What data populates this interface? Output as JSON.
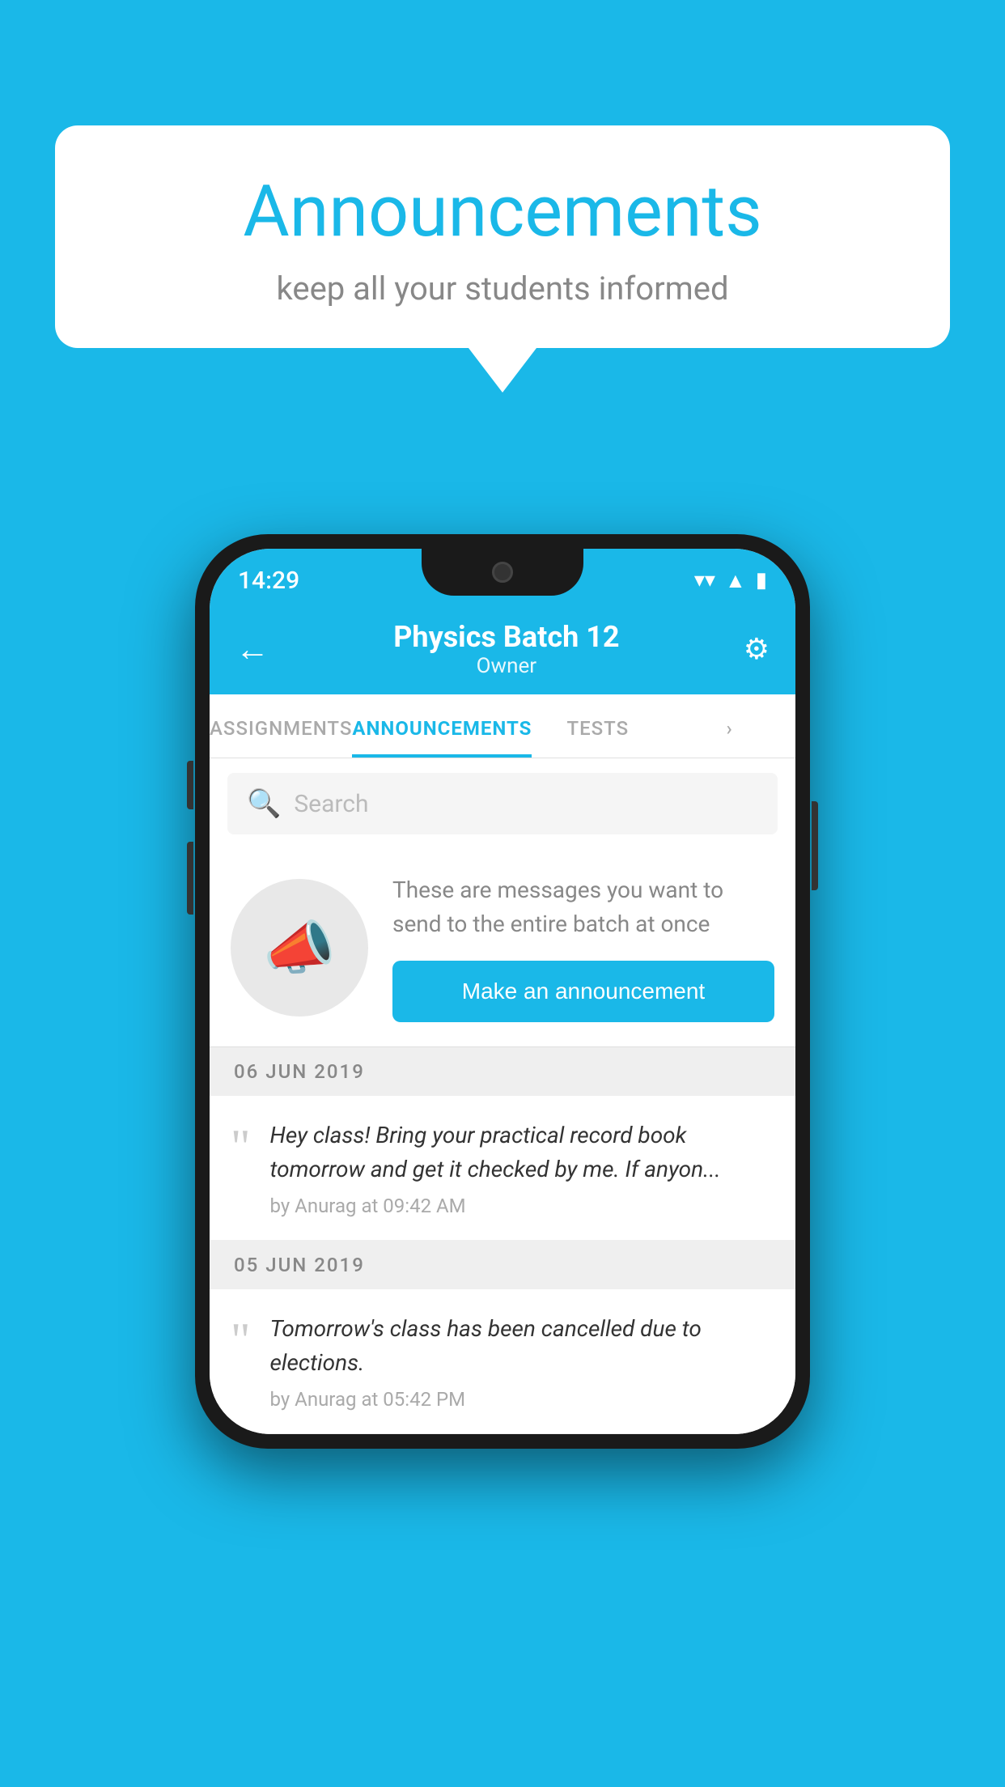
{
  "background_color": "#1ab8e8",
  "speech_bubble": {
    "title": "Announcements",
    "subtitle": "keep all your students informed"
  },
  "phone": {
    "status_bar": {
      "time": "14:29",
      "wifi": "▼",
      "signal": "▲",
      "battery": "▮"
    },
    "header": {
      "title": "Physics Batch 12",
      "subtitle": "Owner",
      "back_label": "←",
      "settings_label": "⚙"
    },
    "tabs": [
      {
        "label": "ASSIGNMENTS",
        "active": false
      },
      {
        "label": "ANNOUNCEMENTS",
        "active": true
      },
      {
        "label": "TESTS",
        "active": false
      },
      {
        "label": "...",
        "active": false
      }
    ],
    "search": {
      "placeholder": "Search"
    },
    "announcement_intro": {
      "description": "These are messages you want to send to the entire batch at once",
      "button_label": "Make an announcement"
    },
    "announcements": [
      {
        "date": "06  JUN  2019",
        "text": "Hey class! Bring your practical record book tomorrow and get it checked by me. If anyon...",
        "meta": "by Anurag at 09:42 AM"
      },
      {
        "date": "05  JUN  2019",
        "text": "Tomorrow's class has been cancelled due to elections.",
        "meta": "by Anurag at 05:42 PM"
      }
    ]
  }
}
